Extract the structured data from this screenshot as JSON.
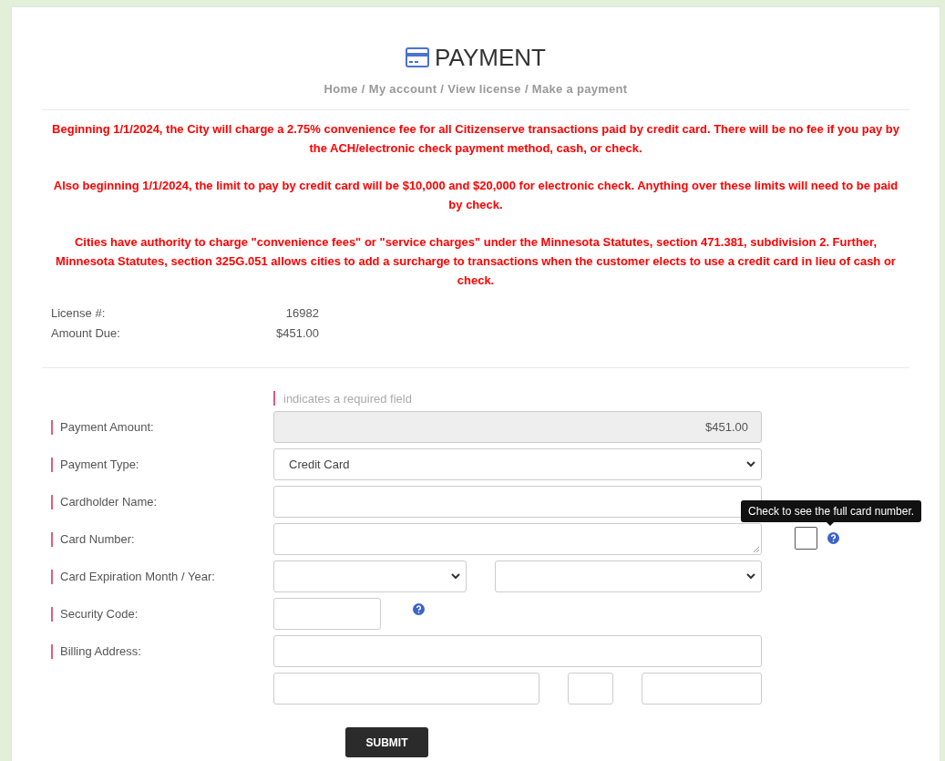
{
  "title": "PAYMENT",
  "breadcrumb": {
    "separator": "/",
    "items": [
      "Home",
      "My account",
      "View license",
      "Make a payment"
    ]
  },
  "notices": [
    "Beginning 1/1/2024, the City will charge a 2.75% convenience fee for all Citizenserve transactions paid by credit card. There will be no fee if you pay by the ACH/electronic check payment method, cash, or check.",
    "Also beginning 1/1/2024, the limit to pay by credit card will be $10,000 and $20,000 for electronic check. Anything over these limits will need to be paid by check.",
    "Cities have authority to charge \"convenience fees\" or \"service charges\" under the Minnesota Statutes, section 471.381, subdivision 2. Further, Minnesota Statutes, section 325G.051 allows cities to add a surcharge to transactions when the customer elects to use a credit card in lieu of cash or check."
  ],
  "summary": [
    {
      "label": "License #:",
      "value": "16982"
    },
    {
      "label": "Amount Due:",
      "value": "$451.00"
    }
  ],
  "required_note": "indicates a required field",
  "fields": [
    {
      "kind": "readonly",
      "label": "Payment Amount:",
      "value": "$451.00"
    },
    {
      "kind": "select",
      "label": "Payment Type:",
      "value": "Credit Card"
    },
    {
      "kind": "text",
      "label": "Cardholder Name:"
    },
    {
      "kind": "card",
      "label": "Card Number:",
      "show_full": {
        "checked": false,
        "tooltip": "Check to see the full card number."
      }
    },
    {
      "kind": "expiry",
      "label": "Card Expiration Month / Year:"
    },
    {
      "kind": "code",
      "label": "Security Code:"
    },
    {
      "kind": "address",
      "label": "Billing Address:"
    }
  ],
  "submit": "SUBMIT"
}
